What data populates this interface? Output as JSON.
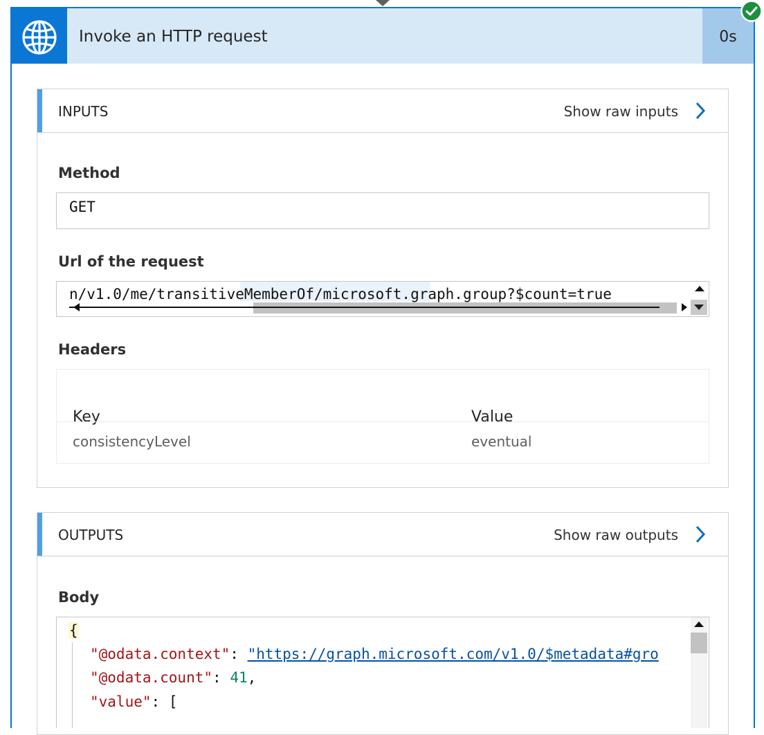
{
  "action": {
    "title": "Invoke an HTTP request",
    "duration": "0s",
    "icon": "globe-icon",
    "status_icon": "success-check-icon",
    "accent_color": "#0078d4"
  },
  "inputs": {
    "label": "INPUTS",
    "raw_link": "Show raw inputs",
    "method_label": "Method",
    "method_value": "GET",
    "url_label": "Url of the request",
    "url_value": "n/v1.0/me/transitiveMemberOf/microsoft.graph.group?$count=true",
    "headers_label": "Headers",
    "headers": {
      "key_col": "Key",
      "value_col": "Value",
      "rows": [
        {
          "key": "consistencyLevel",
          "value": "eventual"
        }
      ]
    }
  },
  "outputs": {
    "label": "OUTPUTS",
    "raw_link": "Show raw outputs",
    "body_label": "Body",
    "body": {
      "open_brace": "{",
      "context_key": "\"@odata.context\"",
      "context_value": "\"https://graph.microsoft.com/v1.0/$metadata#gro",
      "count_key": "\"@odata.count\"",
      "count_value": "41",
      "value_key": "\"value\"",
      "value_open": "["
    }
  }
}
